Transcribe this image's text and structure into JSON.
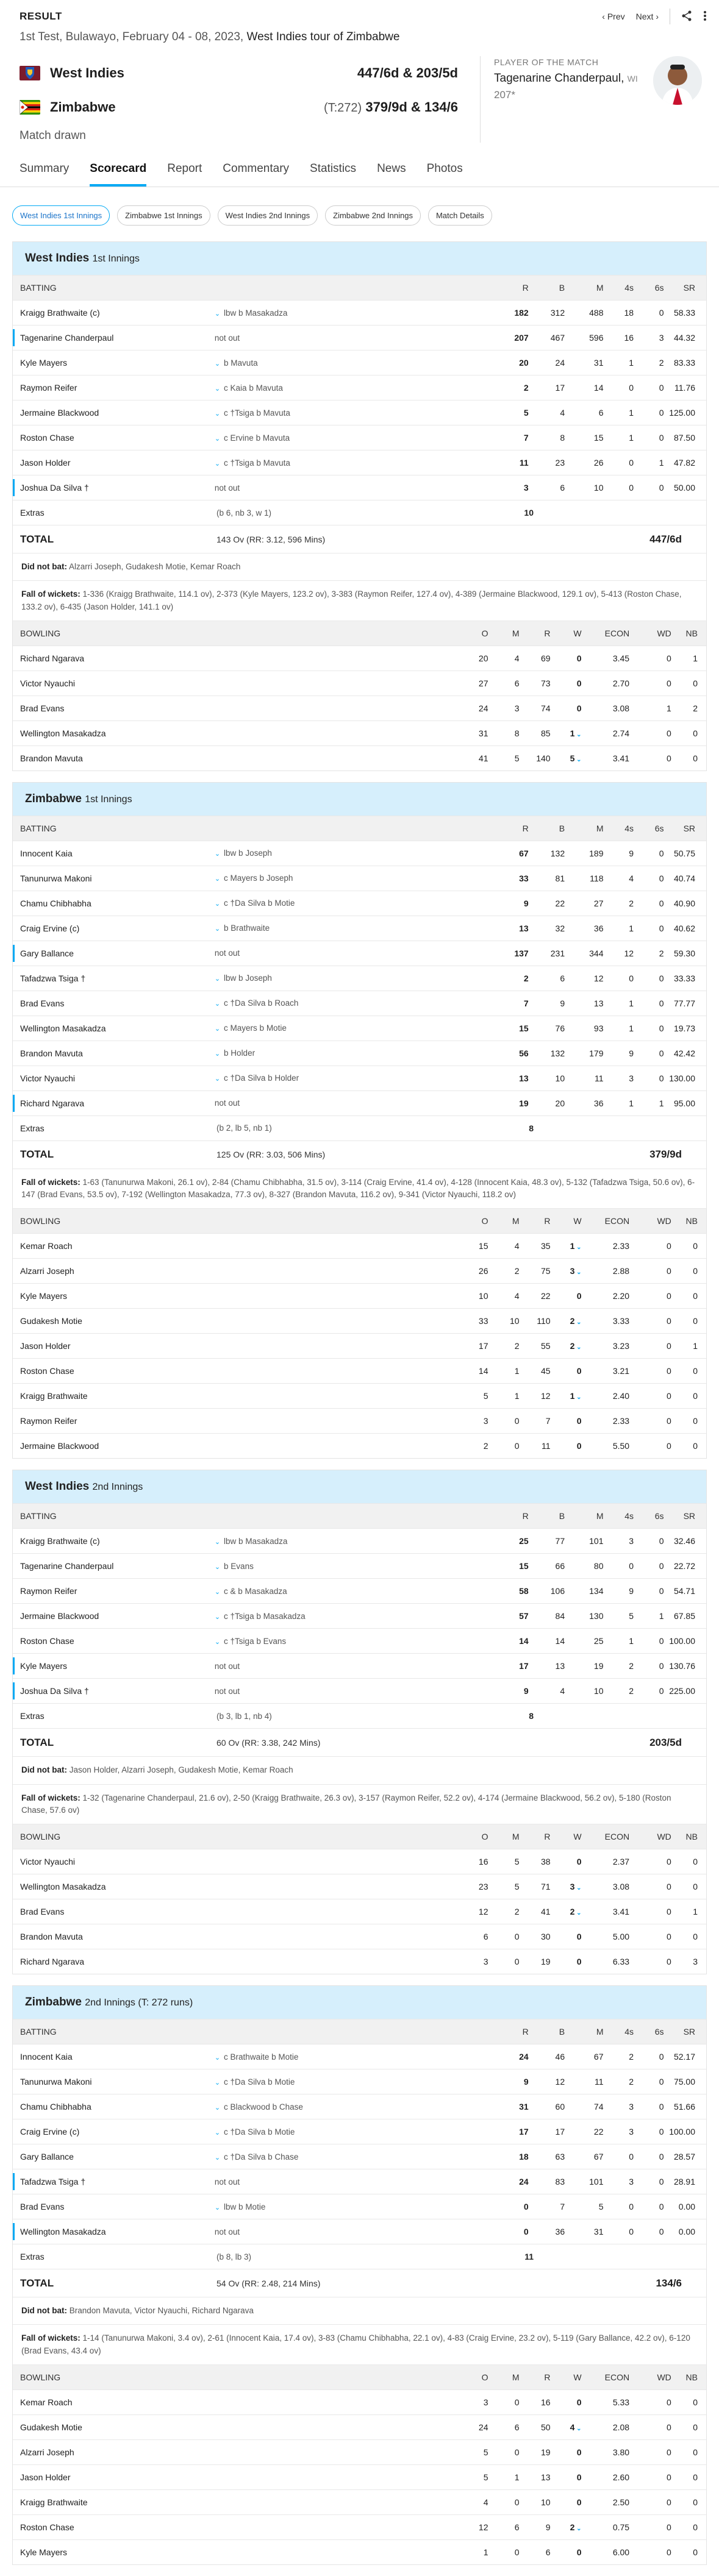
{
  "header": {
    "result_label": "RESULT",
    "prev": "Prev",
    "next": "Next",
    "info_prefix": "1st Test, Bulawayo, February 04 - 08, 2023,",
    "series": "West Indies tour of Zimbabwe"
  },
  "match": {
    "team1": {
      "name": "West Indies",
      "score": "447/6d & 203/5d"
    },
    "team2": {
      "name": "Zimbabwe",
      "target": "(T:272)",
      "score": "379/9d & 134/6"
    },
    "status": "Match drawn",
    "pom": {
      "title": "PLAYER OF THE MATCH",
      "name": "Tagenarine Chanderpaul",
      "team": "WI",
      "score": "207*"
    }
  },
  "tabs": [
    "Summary",
    "Scorecard",
    "Report",
    "Commentary",
    "Statistics",
    "News",
    "Photos"
  ],
  "subtabs": [
    "West Indies 1st Innings",
    "Zimbabwe 1st Innings",
    "West Indies 2nd Innings",
    "Zimbabwe 2nd Innings",
    "Match Details"
  ],
  "bat_headers": {
    "batting": "BATTING",
    "r": "R",
    "b": "B",
    "m": "M",
    "fours": "4s",
    "sixes": "6s",
    "sr": "SR"
  },
  "bowl_headers": {
    "bowling": "BOWLING",
    "o": "O",
    "m": "M",
    "r": "R",
    "w": "W",
    "econ": "ECON",
    "wd": "WD",
    "nb": "NB"
  },
  "labels": {
    "extras": "Extras",
    "total": "TOTAL",
    "dnb": "Did not bat:",
    "fow": "Fall of wickets:"
  },
  "innings": [
    {
      "team": "West Indies",
      "inn": "1st Innings",
      "batting": [
        {
          "name": "Kraigg Brathwaite (c)",
          "dis": "lbw b Masakadza",
          "r": "182",
          "b": "312",
          "m": "488",
          "f": "18",
          "s": "0",
          "sr": "58.33",
          "hl": false
        },
        {
          "name": "Tagenarine Chanderpaul",
          "dis": "not out",
          "r": "207",
          "b": "467",
          "m": "596",
          "f": "16",
          "s": "3",
          "sr": "44.32",
          "hl": true
        },
        {
          "name": "Kyle Mayers",
          "dis": "b Mavuta",
          "r": "20",
          "b": "24",
          "m": "31",
          "f": "1",
          "s": "2",
          "sr": "83.33",
          "hl": false
        },
        {
          "name": "Raymon Reifer",
          "dis": "c Kaia b Mavuta",
          "r": "2",
          "b": "17",
          "m": "14",
          "f": "0",
          "s": "0",
          "sr": "11.76",
          "hl": false
        },
        {
          "name": "Jermaine Blackwood",
          "dis": "c †Tsiga b Mavuta",
          "r": "5",
          "b": "4",
          "m": "6",
          "f": "1",
          "s": "0",
          "sr": "125.00",
          "hl": false
        },
        {
          "name": "Roston Chase",
          "dis": "c Ervine b Mavuta",
          "r": "7",
          "b": "8",
          "m": "15",
          "f": "1",
          "s": "0",
          "sr": "87.50",
          "hl": false
        },
        {
          "name": "Jason Holder",
          "dis": "c †Tsiga b Mavuta",
          "r": "11",
          "b": "23",
          "m": "26",
          "f": "0",
          "s": "1",
          "sr": "47.82",
          "hl": false
        },
        {
          "name": "Joshua Da Silva †",
          "dis": "not out",
          "r": "3",
          "b": "6",
          "m": "10",
          "f": "0",
          "s": "0",
          "sr": "50.00",
          "hl": true
        }
      ],
      "extras_detail": "(b 6, nb 3, w 1)",
      "extras": "10",
      "total_overs": "143 Ov (RR: 3.12, 596 Mins)",
      "total": "447/6d",
      "dnb": "Alzarri Joseph,  Gudakesh Motie,  Kemar Roach",
      "fow": "1-336 (Kraigg Brathwaite, 114.1 ov), 2-373 (Kyle Mayers, 123.2 ov), 3-383 (Raymon Reifer, 127.4 ov), 4-389 (Jermaine Blackwood, 129.1 ov), 5-413 (Roston Chase, 133.2 ov), 6-435 (Jason Holder, 141.1 ov)",
      "bowling": [
        {
          "name": "Richard Ngarava",
          "o": "20",
          "m": "4",
          "r": "69",
          "w": "0",
          "econ": "3.45",
          "wd": "0",
          "nb": "1"
        },
        {
          "name": "Victor Nyauchi",
          "o": "27",
          "m": "6",
          "r": "73",
          "w": "0",
          "econ": "2.70",
          "wd": "0",
          "nb": "0"
        },
        {
          "name": "Brad Evans",
          "o": "24",
          "m": "3",
          "r": "74",
          "w": "0",
          "econ": "3.08",
          "wd": "1",
          "nb": "2"
        },
        {
          "name": "Wellington Masakadza",
          "o": "31",
          "m": "8",
          "r": "85",
          "w": "1",
          "econ": "2.74",
          "wd": "0",
          "nb": "0"
        },
        {
          "name": "Brandon Mavuta",
          "o": "41",
          "m": "5",
          "r": "140",
          "w": "5",
          "econ": "3.41",
          "wd": "0",
          "nb": "0"
        }
      ]
    },
    {
      "team": "Zimbabwe",
      "inn": "1st Innings",
      "batting": [
        {
          "name": "Innocent Kaia",
          "dis": "lbw b Joseph",
          "r": "67",
          "b": "132",
          "m": "189",
          "f": "9",
          "s": "0",
          "sr": "50.75",
          "hl": false
        },
        {
          "name": "Tanunurwa Makoni",
          "dis": "c Mayers b Joseph",
          "r": "33",
          "b": "81",
          "m": "118",
          "f": "4",
          "s": "0",
          "sr": "40.74",
          "hl": false
        },
        {
          "name": "Chamu Chibhabha",
          "dis": "c †Da Silva b Motie",
          "r": "9",
          "b": "22",
          "m": "27",
          "f": "2",
          "s": "0",
          "sr": "40.90",
          "hl": false
        },
        {
          "name": "Craig Ervine (c)",
          "dis": "b Brathwaite",
          "r": "13",
          "b": "32",
          "m": "36",
          "f": "1",
          "s": "0",
          "sr": "40.62",
          "hl": false
        },
        {
          "name": "Gary Ballance",
          "dis": "not out",
          "r": "137",
          "b": "231",
          "m": "344",
          "f": "12",
          "s": "2",
          "sr": "59.30",
          "hl": true
        },
        {
          "name": "Tafadzwa Tsiga †",
          "dis": "lbw b Joseph",
          "r": "2",
          "b": "6",
          "m": "12",
          "f": "0",
          "s": "0",
          "sr": "33.33",
          "hl": false
        },
        {
          "name": "Brad Evans",
          "dis": "c †Da Silva b Roach",
          "r": "7",
          "b": "9",
          "m": "13",
          "f": "1",
          "s": "0",
          "sr": "77.77",
          "hl": false
        },
        {
          "name": "Wellington Masakadza",
          "dis": "c Mayers b Motie",
          "r": "15",
          "b": "76",
          "m": "93",
          "f": "1",
          "s": "0",
          "sr": "19.73",
          "hl": false
        },
        {
          "name": "Brandon Mavuta",
          "dis": "b Holder",
          "r": "56",
          "b": "132",
          "m": "179",
          "f": "9",
          "s": "0",
          "sr": "42.42",
          "hl": false
        },
        {
          "name": "Victor Nyauchi",
          "dis": "c †Da Silva b Holder",
          "r": "13",
          "b": "10",
          "m": "11",
          "f": "3",
          "s": "0",
          "sr": "130.00",
          "hl": false
        },
        {
          "name": "Richard Ngarava",
          "dis": "not out",
          "r": "19",
          "b": "20",
          "m": "36",
          "f": "1",
          "s": "1",
          "sr": "95.00",
          "hl": true
        }
      ],
      "extras_detail": "(b 2, lb 5, nb 1)",
      "extras": "8",
      "total_overs": "125 Ov (RR: 3.03, 506 Mins)",
      "total": "379/9d",
      "dnb": "",
      "fow": "1-63 (Tanunurwa Makoni, 26.1 ov), 2-84 (Chamu Chibhabha, 31.5 ov), 3-114 (Craig Ervine, 41.4 ov), 4-128 (Innocent Kaia, 48.3 ov), 5-132 (Tafadzwa Tsiga, 50.6 ov), 6-147 (Brad Evans, 53.5 ov), 7-192 (Wellington Masakadza, 77.3 ov), 8-327 (Brandon Mavuta, 116.2 ov), 9-341 (Victor Nyauchi, 118.2 ov)",
      "bowling": [
        {
          "name": "Kemar Roach",
          "o": "15",
          "m": "4",
          "r": "35",
          "w": "1",
          "econ": "2.33",
          "wd": "0",
          "nb": "0"
        },
        {
          "name": "Alzarri Joseph",
          "o": "26",
          "m": "2",
          "r": "75",
          "w": "3",
          "econ": "2.88",
          "wd": "0",
          "nb": "0"
        },
        {
          "name": "Kyle Mayers",
          "o": "10",
          "m": "4",
          "r": "22",
          "w": "0",
          "econ": "2.20",
          "wd": "0",
          "nb": "0"
        },
        {
          "name": "Gudakesh Motie",
          "o": "33",
          "m": "10",
          "r": "110",
          "w": "2",
          "econ": "3.33",
          "wd": "0",
          "nb": "0"
        },
        {
          "name": "Jason Holder",
          "o": "17",
          "m": "2",
          "r": "55",
          "w": "2",
          "econ": "3.23",
          "wd": "0",
          "nb": "1"
        },
        {
          "name": "Roston Chase",
          "o": "14",
          "m": "1",
          "r": "45",
          "w": "0",
          "econ": "3.21",
          "wd": "0",
          "nb": "0"
        },
        {
          "name": "Kraigg Brathwaite",
          "o": "5",
          "m": "1",
          "r": "12",
          "w": "1",
          "econ": "2.40",
          "wd": "0",
          "nb": "0"
        },
        {
          "name": "Raymon Reifer",
          "o": "3",
          "m": "0",
          "r": "7",
          "w": "0",
          "econ": "2.33",
          "wd": "0",
          "nb": "0"
        },
        {
          "name": "Jermaine Blackwood",
          "o": "2",
          "m": "0",
          "r": "11",
          "w": "0",
          "econ": "5.50",
          "wd": "0",
          "nb": "0"
        }
      ]
    },
    {
      "team": "West Indies",
      "inn": "2nd Innings",
      "batting": [
        {
          "name": "Kraigg Brathwaite (c)",
          "dis": "lbw b Masakadza",
          "r": "25",
          "b": "77",
          "m": "101",
          "f": "3",
          "s": "0",
          "sr": "32.46",
          "hl": false
        },
        {
          "name": "Tagenarine Chanderpaul",
          "dis": "b Evans",
          "r": "15",
          "b": "66",
          "m": "80",
          "f": "0",
          "s": "0",
          "sr": "22.72",
          "hl": false
        },
        {
          "name": "Raymon Reifer",
          "dis": "c & b Masakadza",
          "r": "58",
          "b": "106",
          "m": "134",
          "f": "9",
          "s": "0",
          "sr": "54.71",
          "hl": false
        },
        {
          "name": "Jermaine Blackwood",
          "dis": "c †Tsiga b Masakadza",
          "r": "57",
          "b": "84",
          "m": "130",
          "f": "5",
          "s": "1",
          "sr": "67.85",
          "hl": false
        },
        {
          "name": "Roston Chase",
          "dis": "c †Tsiga b Evans",
          "r": "14",
          "b": "14",
          "m": "25",
          "f": "1",
          "s": "0",
          "sr": "100.00",
          "hl": false
        },
        {
          "name": "Kyle Mayers",
          "dis": "not out",
          "r": "17",
          "b": "13",
          "m": "19",
          "f": "2",
          "s": "0",
          "sr": "130.76",
          "hl": true
        },
        {
          "name": "Joshua Da Silva †",
          "dis": "not out",
          "r": "9",
          "b": "4",
          "m": "10",
          "f": "2",
          "s": "0",
          "sr": "225.00",
          "hl": true
        }
      ],
      "extras_detail": "(b 3, lb 1, nb 4)",
      "extras": "8",
      "total_overs": "60 Ov (RR: 3.38, 242 Mins)",
      "total": "203/5d",
      "dnb": "Jason Holder,  Alzarri Joseph,  Gudakesh Motie,  Kemar Roach",
      "fow": "1-32 (Tagenarine Chanderpaul, 21.6 ov), 2-50 (Kraigg Brathwaite, 26.3 ov), 3-157 (Raymon Reifer, 52.2 ov), 4-174 (Jermaine Blackwood, 56.2 ov), 5-180 (Roston Chase, 57.6 ov)",
      "bowling": [
        {
          "name": "Victor Nyauchi",
          "o": "16",
          "m": "5",
          "r": "38",
          "w": "0",
          "econ": "2.37",
          "wd": "0",
          "nb": "0"
        },
        {
          "name": "Wellington Masakadza",
          "o": "23",
          "m": "5",
          "r": "71",
          "w": "3",
          "econ": "3.08",
          "wd": "0",
          "nb": "0"
        },
        {
          "name": "Brad Evans",
          "o": "12",
          "m": "2",
          "r": "41",
          "w": "2",
          "econ": "3.41",
          "wd": "0",
          "nb": "1"
        },
        {
          "name": "Brandon Mavuta",
          "o": "6",
          "m": "0",
          "r": "30",
          "w": "0",
          "econ": "5.00",
          "wd": "0",
          "nb": "0"
        },
        {
          "name": "Richard Ngarava",
          "o": "3",
          "m": "0",
          "r": "19",
          "w": "0",
          "econ": "6.33",
          "wd": "0",
          "nb": "3"
        }
      ]
    },
    {
      "team": "Zimbabwe",
      "inn": "2nd Innings (T: 272 runs)",
      "batting": [
        {
          "name": "Innocent Kaia",
          "dis": "c Brathwaite b Motie",
          "r": "24",
          "b": "46",
          "m": "67",
          "f": "2",
          "s": "0",
          "sr": "52.17",
          "hl": false
        },
        {
          "name": "Tanunurwa Makoni",
          "dis": "c †Da Silva b Motie",
          "r": "9",
          "b": "12",
          "m": "11",
          "f": "2",
          "s": "0",
          "sr": "75.00",
          "hl": false
        },
        {
          "name": "Chamu Chibhabha",
          "dis": "c Blackwood b Chase",
          "r": "31",
          "b": "60",
          "m": "74",
          "f": "3",
          "s": "0",
          "sr": "51.66",
          "hl": false
        },
        {
          "name": "Craig Ervine (c)",
          "dis": "c †Da Silva b Motie",
          "r": "17",
          "b": "17",
          "m": "22",
          "f": "3",
          "s": "0",
          "sr": "100.00",
          "hl": false
        },
        {
          "name": "Gary Ballance",
          "dis": "c †Da Silva b Chase",
          "r": "18",
          "b": "63",
          "m": "67",
          "f": "0",
          "s": "0",
          "sr": "28.57",
          "hl": false
        },
        {
          "name": "Tafadzwa Tsiga †",
          "dis": "not out",
          "r": "24",
          "b": "83",
          "m": "101",
          "f": "3",
          "s": "0",
          "sr": "28.91",
          "hl": true
        },
        {
          "name": "Brad Evans",
          "dis": "lbw b Motie",
          "r": "0",
          "b": "7",
          "m": "5",
          "f": "0",
          "s": "0",
          "sr": "0.00",
          "hl": false
        },
        {
          "name": "Wellington Masakadza",
          "dis": "not out",
          "r": "0",
          "b": "36",
          "m": "31",
          "f": "0",
          "s": "0",
          "sr": "0.00",
          "hl": true
        }
      ],
      "extras_detail": "(b 8, lb 3)",
      "extras": "11",
      "total_overs": "54 Ov (RR: 2.48, 214 Mins)",
      "total": "134/6",
      "dnb": "Brandon Mavuta,  Victor Nyauchi,  Richard Ngarava",
      "fow": "1-14 (Tanunurwa Makoni, 3.4 ov), 2-61 (Innocent Kaia, 17.4 ov), 3-83 (Chamu Chibhabha, 22.1 ov), 4-83 (Craig Ervine, 23.2 ov), 5-119 (Gary Ballance, 42.2 ov), 6-120 (Brad Evans, 43.4 ov)",
      "bowling": [
        {
          "name": "Kemar Roach",
          "o": "3",
          "m": "0",
          "r": "16",
          "w": "0",
          "econ": "5.33",
          "wd": "0",
          "nb": "0"
        },
        {
          "name": "Gudakesh Motie",
          "o": "24",
          "m": "6",
          "r": "50",
          "w": "4",
          "econ": "2.08",
          "wd": "0",
          "nb": "0"
        },
        {
          "name": "Alzarri Joseph",
          "o": "5",
          "m": "0",
          "r": "19",
          "w": "0",
          "econ": "3.80",
          "wd": "0",
          "nb": "0"
        },
        {
          "name": "Jason Holder",
          "o": "5",
          "m": "1",
          "r": "13",
          "w": "0",
          "econ": "2.60",
          "wd": "0",
          "nb": "0"
        },
        {
          "name": "Kraigg Brathwaite",
          "o": "4",
          "m": "0",
          "r": "10",
          "w": "0",
          "econ": "2.50",
          "wd": "0",
          "nb": "0"
        },
        {
          "name": "Roston Chase",
          "o": "12",
          "m": "6",
          "r": "9",
          "w": "2",
          "econ": "0.75",
          "wd": "0",
          "nb": "0"
        },
        {
          "name": "Kyle Mayers",
          "o": "1",
          "m": "0",
          "r": "6",
          "w": "0",
          "econ": "6.00",
          "wd": "0",
          "nb": "0"
        }
      ]
    }
  ]
}
